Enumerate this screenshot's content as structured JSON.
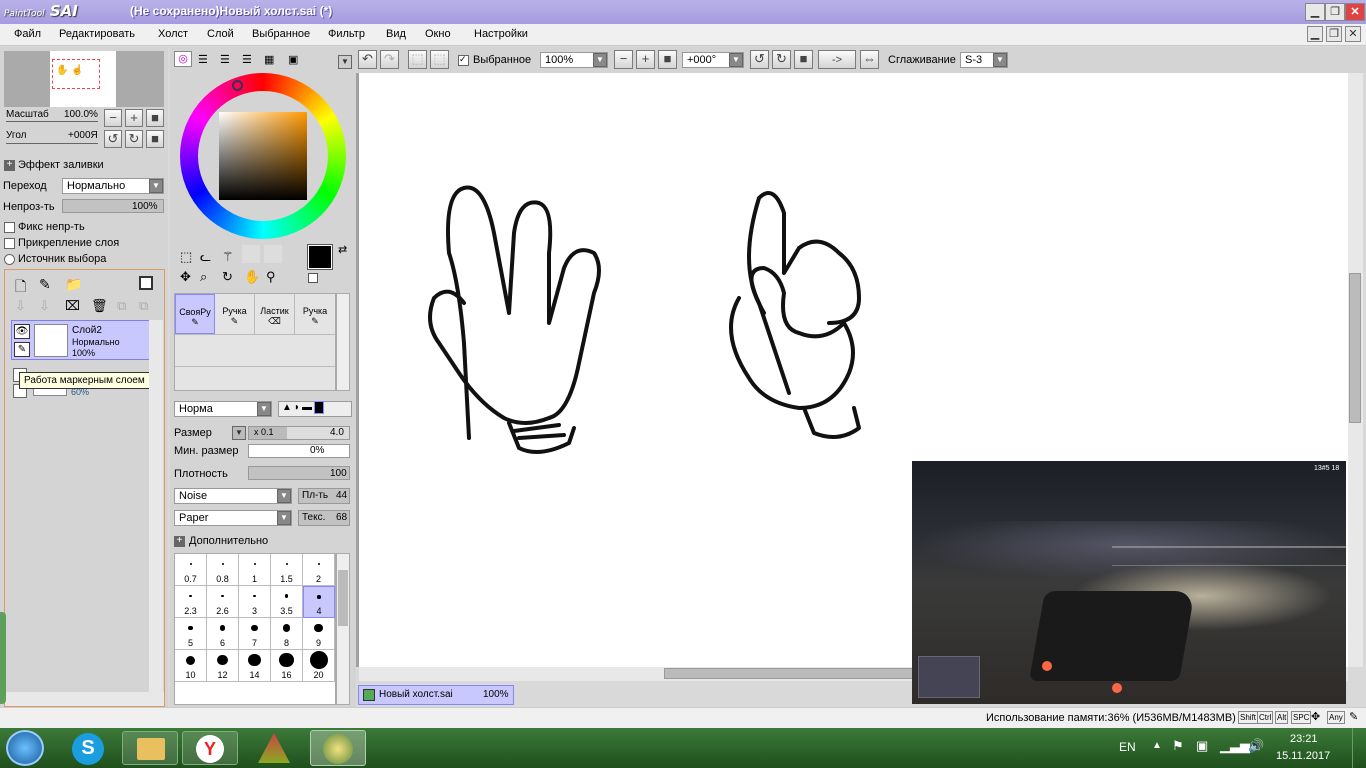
{
  "window": {
    "title": "(Не сохранено)Новый холст.sai (*)",
    "logo_small": "PaintTool",
    "logo_big": "SAI"
  },
  "menu": [
    "Файл",
    "Редактировать",
    "Холст",
    "Слой",
    "Выбранное",
    "Фильтр",
    "Вид",
    "Окно",
    "Настройки"
  ],
  "navigator": {
    "zoom_label": "Масштаб",
    "zoom_value": "100.0%",
    "angle_label": "Угол",
    "angle_value": "+000Я"
  },
  "layer_props": {
    "effect_label": "Эффект заливки",
    "blend_label": "Переход",
    "blend_value": "Нормально",
    "opacity_label": "Непроз-ть",
    "opacity_value": "100%",
    "fix_opacity": "Фикс непр-ть",
    "clip_layer": "Прикрепление слоя",
    "selection_source": "Источник выбора"
  },
  "layers": [
    {
      "name": "Слой2",
      "mode": "Нормально",
      "opacity": "100%"
    },
    {
      "name": "",
      "mode": "",
      "opacity": "60%"
    }
  ],
  "tooltip": "Работа маркерным слоем",
  "colors": {
    "primary": "#000000",
    "secondary": "#8b0a10",
    "accent": "#c8c8ff"
  },
  "tools": [
    {
      "name": "СвояРу"
    },
    {
      "name": "Ручка"
    },
    {
      "name": "Ластик"
    },
    {
      "name": "Ручка"
    }
  ],
  "brush": {
    "mode": "Норма",
    "size_label": "Размер",
    "size_mult": "x 0.1",
    "size_value": "4.0",
    "min_size_label": "Мин. размер",
    "min_size_value": "0%",
    "density_label": "Плотность",
    "density_value": "100",
    "shape1": "Noise",
    "shape1_label": "Пл-ть",
    "shape1_value": "44",
    "shape2": "Paper",
    "shape2_label": "Текс.",
    "shape2_value": "68",
    "advanced": "Дополнительно"
  },
  "brush_sizes": [
    "0.7",
    "0.8",
    "1",
    "1.5",
    "2",
    "2.3",
    "2.6",
    "3",
    "3.5",
    "4",
    "5",
    "6",
    "7",
    "8",
    "9",
    "10",
    "12",
    "14",
    "16",
    "20"
  ],
  "toolbar": {
    "selection": "Выбранное",
    "zoom": "100%",
    "angle": "+000°",
    "arrow": "->",
    "smoothing_label": "Сглаживание",
    "smoothing_value": "S-3"
  },
  "doc_tab": {
    "name": "Новый холст.sai",
    "zoom": "100%"
  },
  "status": {
    "memory": "Использование памяти:36% (И536МВ/М1483МВ)",
    "keys": [
      "Shift",
      "Ctrl",
      "Alt",
      "SPC",
      "Any"
    ]
  },
  "video": {
    "hud": "13#5 18"
  },
  "taskbar": {
    "lang": "EN",
    "time": "23:21",
    "date": "15.11.2017"
  }
}
